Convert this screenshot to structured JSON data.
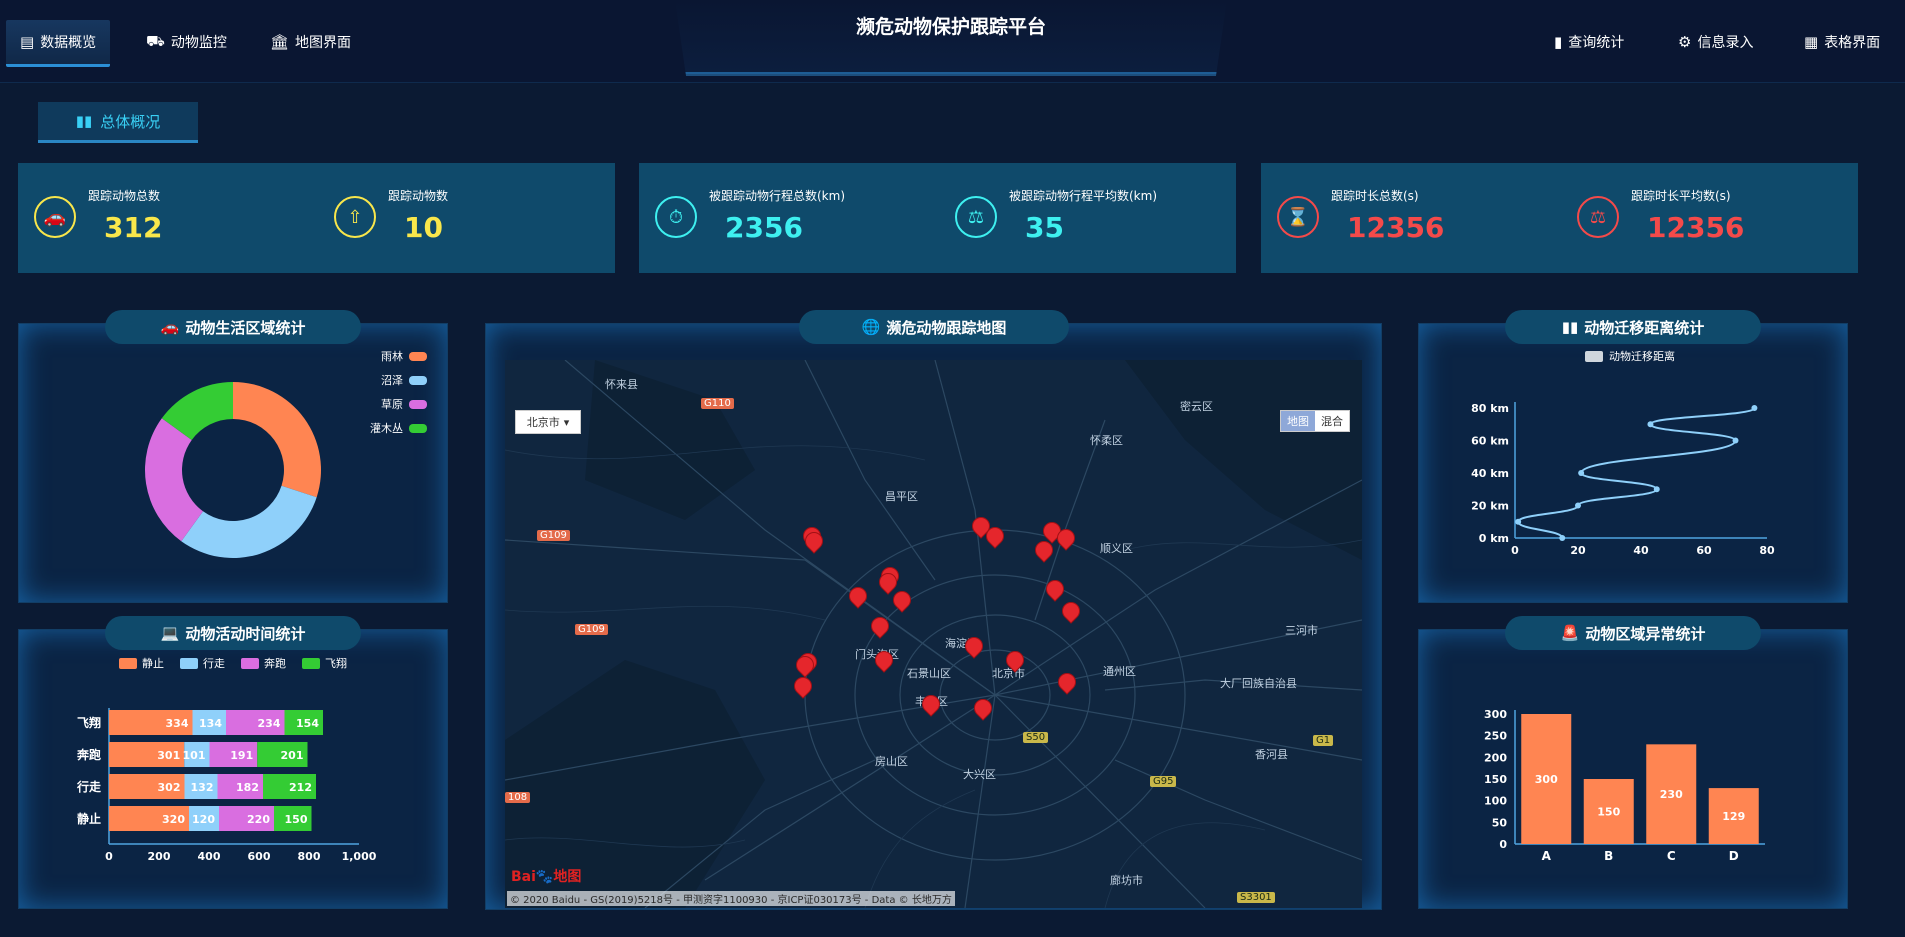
{
  "header": {
    "title": "濒危动物保护跟踪平台",
    "nav_left": [
      {
        "label": "数据概览",
        "icon": "document-icon"
      },
      {
        "label": "动物监控",
        "icon": "truck-icon"
      },
      {
        "label": "地图界面",
        "icon": "bank-icon"
      }
    ],
    "nav_right": [
      {
        "label": "查询统计",
        "icon": "bar-chart-icon"
      },
      {
        "label": "信息录入",
        "icon": "gear-icon"
      },
      {
        "label": "表格界面",
        "icon": "table-icon"
      }
    ]
  },
  "overview_tab": {
    "label": "总体概况"
  },
  "stats": [
    {
      "label": "跟踪动物总数",
      "value": "312",
      "color": "#f9e74b"
    },
    {
      "label": "跟踪动物数",
      "value": "10",
      "color": "#f9e74b"
    },
    {
      "label": "被跟踪动物行程总数(km)",
      "value": "2356",
      "color": "#3ef0f0"
    },
    {
      "label": "被跟踪动物行程平均数(km)",
      "value": "35",
      "color": "#3ef0f0"
    },
    {
      "label": "跟踪时长总数(s)",
      "value": "12356",
      "color": "#f44a4a"
    },
    {
      "label": "跟踪时长平均数(s)",
      "value": "12356",
      "color": "#f44a4a"
    }
  ],
  "panels": {
    "habitat": {
      "title": "动物生活区域统计"
    },
    "activity": {
      "title": "动物活动时间统计"
    },
    "map": {
      "title": "濒危动物跟踪地图"
    },
    "migration": {
      "title": "动物迁移距离统计"
    },
    "abnormal": {
      "title": "动物区域异常统计"
    }
  },
  "map": {
    "city_select": "北京市",
    "type_buttons": [
      "地图",
      "混合"
    ],
    "labels": [
      {
        "text": "怀来县"
      },
      {
        "text": "密云区"
      },
      {
        "text": "怀柔区"
      },
      {
        "text": "昌平区"
      },
      {
        "text": "顺义区"
      },
      {
        "text": "海淀区"
      },
      {
        "text": "门头沟区"
      },
      {
        "text": "石景山区"
      },
      {
        "text": "北京市"
      },
      {
        "text": "丰台区"
      },
      {
        "text": "通州区"
      },
      {
        "text": "三河市"
      },
      {
        "text": "大厂回族自治县"
      },
      {
        "text": "房山区"
      },
      {
        "text": "大兴区"
      },
      {
        "text": "香河县"
      },
      {
        "text": "廊坊市"
      }
    ],
    "road_tags": [
      "G110",
      "G109",
      "G109",
      "108",
      "S50",
      "G95",
      "G1",
      "S3301"
    ],
    "logo": "Bai",
    "logo_suffix": "地图",
    "copyright": "© 2020 Baidu - GS(2019)5218号 - 甲测资字1100930 - 京ICP证030173号 - Data © 长地万方"
  },
  "chart_data": [
    {
      "type": "pie",
      "title": "动物生活区域统计",
      "legend": [
        "雨林",
        "沼泽",
        "草原",
        "灌木丛"
      ],
      "values": [
        30,
        30,
        25,
        15
      ],
      "colors": [
        "#ff8552",
        "#8fd0fa",
        "#d96ee0",
        "#34cc34"
      ],
      "donut": true
    },
    {
      "type": "bar",
      "orientation": "horizontal",
      "stacked": true,
      "title": "动物活动时间统计",
      "categories": [
        "静止",
        "行走",
        "奔跑",
        "飞翔"
      ],
      "series": [
        {
          "name": "静止",
          "values": [
            320,
            302,
            301,
            334
          ],
          "color": "#ff8552"
        },
        {
          "name": "行走",
          "values": [
            120,
            132,
            101,
            134
          ],
          "color": "#8fd0fa"
        },
        {
          "name": "奔跑",
          "values": [
            220,
            182,
            191,
            234
          ],
          "color": "#d96ee0"
        },
        {
          "name": "飞翔",
          "values": [
            150,
            212,
            201,
            154
          ],
          "color": "#34cc34"
        }
      ],
      "xlim": [
        0,
        1000
      ],
      "xticks": [
        "0",
        "200",
        "400",
        "600",
        "800",
        "1,000"
      ]
    },
    {
      "type": "line",
      "title": "动物迁移距离统计",
      "legend": [
        "动物迁移距离"
      ],
      "x": [
        15,
        1,
        20,
        45,
        21,
        70,
        43,
        76
      ],
      "y": [
        0,
        10,
        20,
        30,
        40,
        60,
        70,
        80
      ],
      "xlim": [
        0,
        80
      ],
      "ylim": [
        0,
        80
      ],
      "xticks": [
        "0",
        "20",
        "40",
        "60",
        "80"
      ],
      "yticks": [
        "0 km",
        "20 km",
        "40 km",
        "60 km",
        "80 km"
      ],
      "color": "#8fd0fa"
    },
    {
      "type": "bar",
      "title": "动物区域异常统计",
      "categories": [
        "A",
        "B",
        "C",
        "D"
      ],
      "values": [
        300,
        150,
        230,
        129
      ],
      "ylim": [
        0,
        300
      ],
      "yticks": [
        "0",
        "50",
        "100",
        "150",
        "200",
        "250",
        "300"
      ],
      "color": "#ff8552"
    }
  ]
}
